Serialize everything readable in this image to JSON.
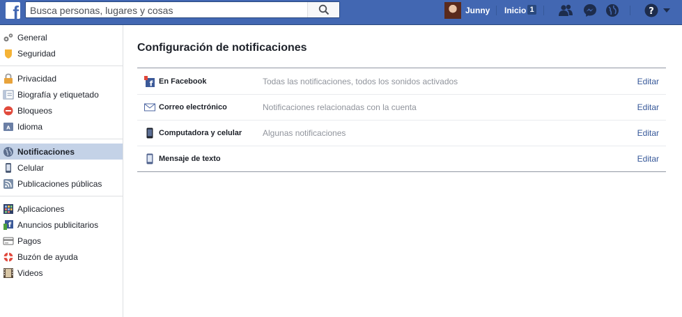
{
  "topbar": {
    "search_placeholder": "Busca personas, lugares y cosas",
    "user_name": "Junny",
    "home_label": "Inicio",
    "home_badge": "1"
  },
  "sidebar": {
    "groups": [
      [
        {
          "label": "General",
          "icon": "gears-icon"
        },
        {
          "label": "Seguridad",
          "icon": "shield-icon"
        }
      ],
      [
        {
          "label": "Privacidad",
          "icon": "lock-icon"
        },
        {
          "label": "Biografía y etiquetado",
          "icon": "timeline-icon"
        },
        {
          "label": "Bloqueos",
          "icon": "block-icon"
        },
        {
          "label": "Idioma",
          "icon": "language-icon"
        }
      ],
      [
        {
          "label": "Notificaciones",
          "icon": "globe-icon",
          "active": true
        },
        {
          "label": "Celular",
          "icon": "mobile-icon"
        },
        {
          "label": "Publicaciones públicas",
          "icon": "rss-icon"
        }
      ],
      [
        {
          "label": "Aplicaciones",
          "icon": "apps-icon"
        },
        {
          "label": "Anuncios publicitarios",
          "icon": "ads-icon"
        },
        {
          "label": "Pagos",
          "icon": "card-icon"
        },
        {
          "label": "Buzón de ayuda",
          "icon": "lifebuoy-icon"
        },
        {
          "label": "Videos",
          "icon": "film-icon"
        }
      ]
    ]
  },
  "main": {
    "title": "Configuración de notificaciones",
    "rows": [
      {
        "label": "En Facebook",
        "desc": "Todas las notificaciones, todos los sonidos activados",
        "edit": "Editar",
        "icon": "facebook-notification-icon"
      },
      {
        "label": "Correo electrónico",
        "desc": "Notificaciones relacionadas con la cuenta",
        "edit": "Editar",
        "icon": "envelope-icon"
      },
      {
        "label": "Computadora y celular",
        "desc": "Algunas notificaciones",
        "edit": "Editar",
        "icon": "phone-icon"
      },
      {
        "label": "Mensaje de texto",
        "desc": "",
        "edit": "Editar",
        "icon": "sms-phone-icon"
      }
    ]
  },
  "colors": {
    "brand": "#4267b2",
    "active_bg": "#c4d2e7",
    "link": "#365899"
  }
}
